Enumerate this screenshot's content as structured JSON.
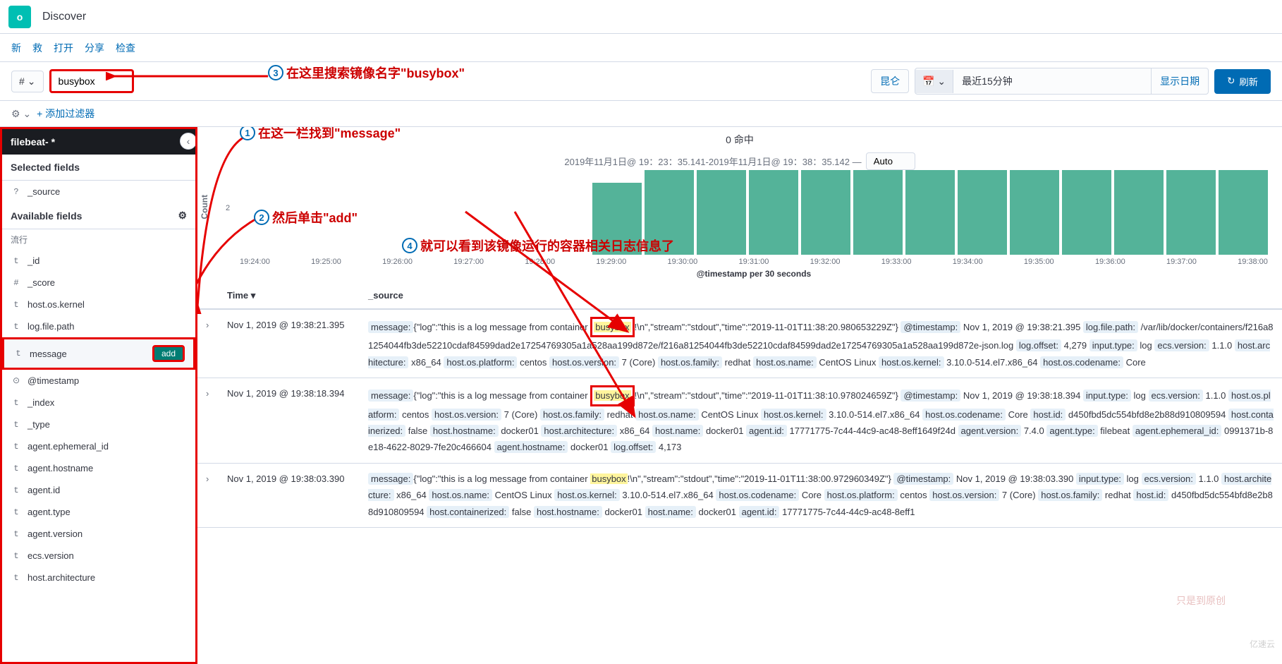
{
  "header": {
    "logo_letter": "o",
    "app_title": "Discover",
    "menu": [
      "新",
      "救",
      "打开",
      "分享",
      "检查"
    ]
  },
  "query": {
    "lang_symbol": "#",
    "search_value": "busybox",
    "kql_label": "昆仑",
    "date_text": "最近15分钟",
    "show_dates": "显示日期",
    "refresh": "刷新"
  },
  "filter_bar": {
    "add_filter": "+ 添加过滤器"
  },
  "sidebar": {
    "index_pattern": "filebeat- *",
    "selected_fields_label": "Selected fields",
    "available_fields_label": "Available fields",
    "popular_label": "流行",
    "selected_fields": [
      {
        "type": "?",
        "name": "_source"
      }
    ],
    "available_fields": [
      {
        "type": "t",
        "name": "_id"
      },
      {
        "type": "#",
        "name": "_score"
      },
      {
        "type": "t",
        "name": "host.os.kernel"
      },
      {
        "type": "t",
        "name": "log.file.path"
      },
      {
        "type": "t",
        "name": "message",
        "add_btn": "add",
        "highlighted": true
      },
      {
        "type": "⊙",
        "name": "@timestamp"
      },
      {
        "type": "t",
        "name": "_index"
      },
      {
        "type": "t",
        "name": "_type"
      },
      {
        "type": "t",
        "name": "agent.ephemeral_id"
      },
      {
        "type": "t",
        "name": "agent.hostname"
      },
      {
        "type": "t",
        "name": "agent.id"
      },
      {
        "type": "t",
        "name": "agent.type"
      },
      {
        "type": "t",
        "name": "agent.version"
      },
      {
        "type": "t",
        "name": "ecs.version"
      },
      {
        "type": "t",
        "name": "host.architecture"
      }
    ]
  },
  "results": {
    "hit_count": "0 命中",
    "time_range": "2019年11月1日@ 19：23：35.141-2019年11月1日@ 19：38：35.142 —",
    "interval": "Auto",
    "y_label": "Count",
    "x_title": "@timestamp per 30 seconds",
    "time_header": "Time ▾",
    "source_header": "_source",
    "rows": [
      {
        "time": "Nov 1, 2019 @ 19:38:21.395",
        "source_parts": [
          {
            "k": "message:",
            "v": "{\"log\":\"this is a log message from container "
          },
          {
            "hl_box": true,
            "hl": "busybox"
          },
          {
            "v": "!\\n\",\"stream\":\"stdout\",\"time\":\"2019-11-01T11:38:20.980653229Z\"} "
          },
          {
            "k": "@timestamp:",
            "v": " Nov 1, 2019 @ 19:38:21.395 "
          },
          {
            "k": "log.file.path:",
            "v": " /var/lib/docker/containers/f216a81254044fb3de52210cdaf84599dad2e17254769305a1a528aa199d872e/f216a81254044fb3de52210cdaf84599dad2e17254769305a1a528aa199d872e-json.log "
          },
          {
            "k": "log.offset:",
            "v": " 4,279 "
          },
          {
            "k": "input.type:",
            "v": " log "
          },
          {
            "k": "ecs.version:",
            "v": " 1.1.0 "
          },
          {
            "k": "host.architecture:",
            "v": " x86_64 "
          },
          {
            "k": "host.os.platform:",
            "v": " centos "
          },
          {
            "k": "host.os.version:",
            "v": " 7 (Core) "
          },
          {
            "k": "host.os.family:",
            "v": " redhat "
          },
          {
            "k": "host.os.name:",
            "v": " CentOS Linux "
          },
          {
            "k": "host.os.kernel:",
            "v": " 3.10.0-514.el7.x86_64 "
          },
          {
            "k": "host.os.codename:",
            "v": " Core"
          }
        ]
      },
      {
        "time": "Nov 1, 2019 @ 19:38:18.394",
        "source_parts": [
          {
            "k": "message:",
            "v": "{\"log\":\"this is a log message from container "
          },
          {
            "hl_box": true,
            "hl": "busybox"
          },
          {
            "v": "!\\n\",\"stream\":\"stdout\",\"time\":\"2019-11-01T11:38:10.978024659Z\"} "
          },
          {
            "k": "@timestamp:",
            "v": " Nov 1, 2019 @ 19:38:18.394 "
          },
          {
            "k": "input.type:",
            "v": " log "
          },
          {
            "k": "ecs.version:",
            "v": " 1.1.0 "
          },
          {
            "k": "host.os.platform:",
            "v": " centos "
          },
          {
            "k": "host.os.version:",
            "v": " 7 (Core) "
          },
          {
            "k": "host.os.family:",
            "v": " redhat "
          },
          {
            "k": "host.os.name:",
            "v": " CentOS Linux "
          },
          {
            "k": "host.os.kernel:",
            "v": " 3.10.0-514.el7.x86_64 "
          },
          {
            "k": "host.os.codename:",
            "v": " Core "
          },
          {
            "k": "host.id:",
            "v": " d450fbd5dc554bfd8e2b88d910809594 "
          },
          {
            "k": "host.containerized:",
            "v": " false "
          },
          {
            "k": "host.hostname:",
            "v": " docker01 "
          },
          {
            "k": "host.architecture:",
            "v": " x86_64 "
          },
          {
            "k": "host.name:",
            "v": " docker01 "
          },
          {
            "k": "agent.id:",
            "v": " 17771775-7c44-44c9-ac48-8eff1649f24d "
          },
          {
            "k": "agent.version:",
            "v": " 7.4.0 "
          },
          {
            "k": "agent.type:",
            "v": " filebeat "
          },
          {
            "k": "agent.ephemeral_id:",
            "v": " 0991371b-8e18-4622-8029-7fe20c466604 "
          },
          {
            "k": "agent.hostname:",
            "v": " docker01 "
          },
          {
            "k": "log.offset:",
            "v": " 4,173"
          }
        ]
      },
      {
        "time": "Nov 1, 2019 @ 19:38:03.390",
        "source_parts": [
          {
            "k": "message:",
            "v": "{\"log\":\"this is a log message from container "
          },
          {
            "hl": "busybox"
          },
          {
            "v": "!\\n\",\"stream\":\"stdout\",\"time\":\"2019-11-01T11:38:00.972960349Z\"} "
          },
          {
            "k": "@timestamp:",
            "v": " Nov 1, 2019 @ 19:38:03.390 "
          },
          {
            "k": "input.type:",
            "v": " log "
          },
          {
            "k": "ecs.version:",
            "v": " 1.1.0 "
          },
          {
            "k": "host.architecture:",
            "v": " x86_64 "
          },
          {
            "k": "host.os.name:",
            "v": " CentOS Linux "
          },
          {
            "k": "host.os.kernel:",
            "v": " 3.10.0-514.el7.x86_64 "
          },
          {
            "k": "host.os.codename:",
            "v": " Core "
          },
          {
            "k": "host.os.platform:",
            "v": " centos "
          },
          {
            "k": "host.os.version:",
            "v": " 7 (Core) "
          },
          {
            "k": "host.os.family:",
            "v": " redhat "
          },
          {
            "k": "host.id:",
            "v": " d450fbd5dc554bfd8e2b88d910809594 "
          },
          {
            "k": "host.containerized:",
            "v": " false "
          },
          {
            "k": "host.hostname:",
            "v": " docker01 "
          },
          {
            "k": "host.name:",
            "v": " docker01 "
          },
          {
            "k": "agent.id:",
            "v": " 17771775-7c44-44c9-ac48-8eff1"
          }
        ]
      }
    ]
  },
  "annotations": {
    "a1": "在这一栏找到\"message\"",
    "a2": "然后单击\"add\"",
    "a3": "在这里搜索镜像名字\"busybox\"",
    "a4": "就可以看到该镜像运行的容器相关日志信息了"
  },
  "chart_data": {
    "type": "bar",
    "x_ticks": [
      "19:24:00",
      "19:25:00",
      "19:26:00",
      "19:27:00",
      "19:28:00",
      "19:29:00",
      "19:30:00",
      "19:31:00",
      "19:32:00",
      "19:33:00",
      "19:34:00",
      "19:35:00",
      "19:36:00",
      "19:37:00",
      "19:38:00"
    ],
    "bars": [
      1.7,
      2,
      2,
      2,
      2,
      2,
      2,
      2,
      2,
      2,
      2,
      2,
      2
    ],
    "ylabel": "Count",
    "x_title": "@timestamp per 30 seconds",
    "y_ticks": [
      2
    ]
  },
  "watermark": "亿速云",
  "watermark2": "只是到原创"
}
